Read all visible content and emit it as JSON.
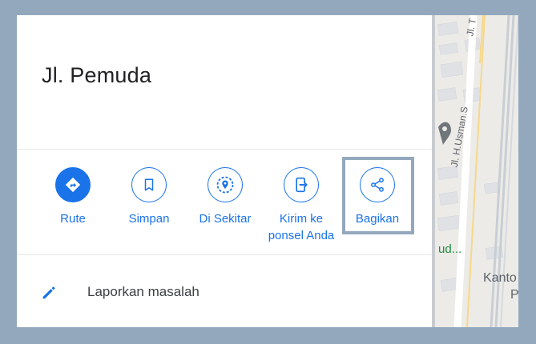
{
  "place": {
    "title": "Jl. Pemuda"
  },
  "actions": [
    {
      "label": "Rute"
    },
    {
      "label": "Simpan"
    },
    {
      "label": "Di Sekitar"
    },
    {
      "label": "Kirim ke ponsel Anda"
    },
    {
      "label": "Bagikan"
    }
  ],
  "report": {
    "label": "Laporkan masalah"
  },
  "map": {
    "street_label_1": "Jl. H.Usman.S",
    "street_label_2": "Jl. T",
    "poi_partial": "ud...",
    "place_partial_1": "Kanto",
    "place_partial_2": "P"
  },
  "colors": {
    "accent": "#1a73e8",
    "frame": "#93a8bd"
  }
}
